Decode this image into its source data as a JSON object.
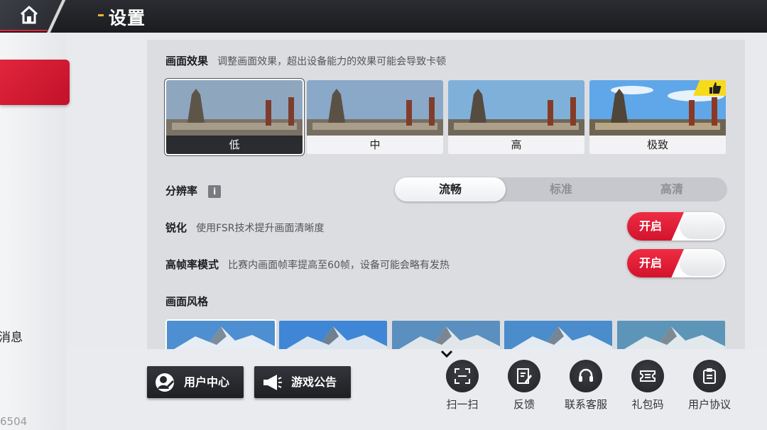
{
  "header": {
    "title": "设置"
  },
  "sidebar": {
    "message_label": "消息",
    "version": "6504"
  },
  "graphics": {
    "title": "画面效果",
    "description": "调整画面效果，超出设备能力的效果可能会导致卡顿",
    "options": [
      {
        "label": "低",
        "selected": true
      },
      {
        "label": "中",
        "selected": false
      },
      {
        "label": "高",
        "selected": false
      },
      {
        "label": "极致",
        "selected": false,
        "recommended": true
      }
    ]
  },
  "resolution": {
    "title": "分辨率",
    "info_icon": "info-icon",
    "options": [
      "流畅",
      "标准",
      "高清"
    ],
    "selected": "流畅"
  },
  "sharpen": {
    "title": "锐化",
    "description": "使用FSR技术提升画面清晰度",
    "toggle_label": "开启"
  },
  "high_fps": {
    "title": "高帧率模式",
    "description": "比赛内画面帧率提高至60帧，设备可能会略有发热",
    "toggle_label": "开启"
  },
  "style": {
    "title": "画面风格",
    "selected_index": 0,
    "count": 5
  },
  "bottom": {
    "user_center": "用户中心",
    "announcement": "游戏公告",
    "tools": [
      {
        "label": "扫一扫",
        "icon": "scan-icon"
      },
      {
        "label": "反馈",
        "icon": "feedback-icon"
      },
      {
        "label": "联系客服",
        "icon": "headset-icon"
      },
      {
        "label": "礼包码",
        "icon": "ticket-icon"
      },
      {
        "label": "用户协议",
        "icon": "clipboard-icon"
      }
    ]
  },
  "colors": {
    "accent": "#d3132c",
    "badge": "#f6da1c",
    "dark": "#1f2024"
  }
}
